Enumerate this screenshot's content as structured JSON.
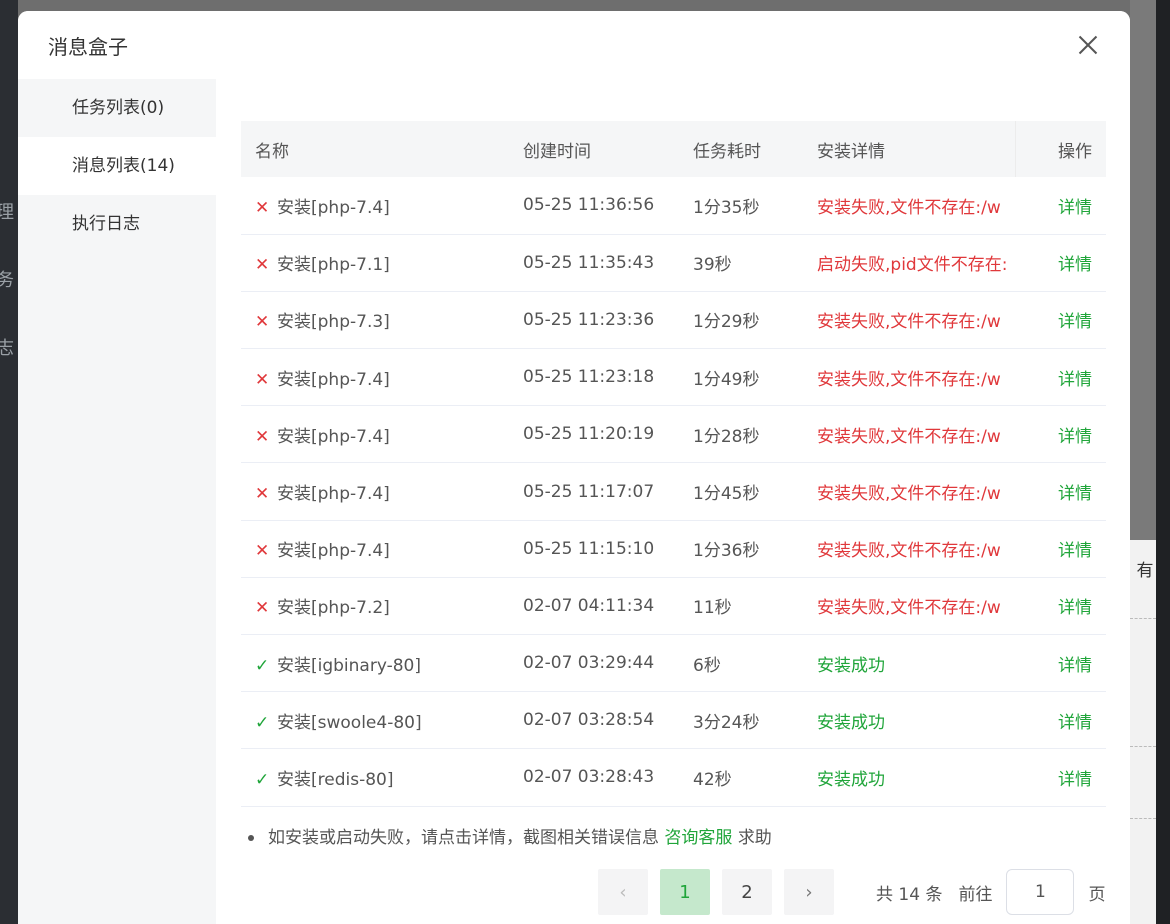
{
  "backdrop": {
    "left_chars": [
      "理",
      "务",
      "志"
    ],
    "right_text": "有"
  },
  "modal": {
    "title": "消息盒子"
  },
  "sidebar": {
    "items": [
      {
        "label": "任务列表(0)"
      },
      {
        "label": "消息列表(14)"
      },
      {
        "label": "执行日志"
      }
    ],
    "active_index": 1
  },
  "table": {
    "columns": [
      "名称",
      "创建时间",
      "任务耗时",
      "安装详情",
      "操作"
    ],
    "rows": [
      {
        "status": "fail",
        "name": "安装[php-7.4]",
        "created": "05-25 11:36:56",
        "duration": "1分35秒",
        "detail": "安装失败,文件不存在:/w",
        "action": "详情"
      },
      {
        "status": "fail",
        "name": "安装[php-7.1]",
        "created": "05-25 11:35:43",
        "duration": "39秒",
        "detail": "启动失败,pid文件不存在:",
        "action": "详情"
      },
      {
        "status": "fail",
        "name": "安装[php-7.3]",
        "created": "05-25 11:23:36",
        "duration": "1分29秒",
        "detail": "安装失败,文件不存在:/w",
        "action": "详情"
      },
      {
        "status": "fail",
        "name": "安装[php-7.4]",
        "created": "05-25 11:23:18",
        "duration": "1分49秒",
        "detail": "安装失败,文件不存在:/w",
        "action": "详情"
      },
      {
        "status": "fail",
        "name": "安装[php-7.4]",
        "created": "05-25 11:20:19",
        "duration": "1分28秒",
        "detail": "安装失败,文件不存在:/w",
        "action": "详情"
      },
      {
        "status": "fail",
        "name": "安装[php-7.4]",
        "created": "05-25 11:17:07",
        "duration": "1分45秒",
        "detail": "安装失败,文件不存在:/w",
        "action": "详情"
      },
      {
        "status": "fail",
        "name": "安装[php-7.4]",
        "created": "05-25 11:15:10",
        "duration": "1分36秒",
        "detail": "安装失败,文件不存在:/w",
        "action": "详情"
      },
      {
        "status": "fail",
        "name": "安装[php-7.2]",
        "created": "02-07 04:11:34",
        "duration": "11秒",
        "detail": "安装失败,文件不存在:/w",
        "action": "详情"
      },
      {
        "status": "ok",
        "name": "安装[igbinary-80]",
        "created": "02-07 03:29:44",
        "duration": "6秒",
        "detail": "安装成功",
        "action": "详情"
      },
      {
        "status": "ok",
        "name": "安装[swoole4-80]",
        "created": "02-07 03:28:54",
        "duration": "3分24秒",
        "detail": "安装成功",
        "action": "详情"
      },
      {
        "status": "ok",
        "name": "安装[redis-80]",
        "created": "02-07 03:28:43",
        "duration": "42秒",
        "detail": "安装成功",
        "action": "详情"
      }
    ]
  },
  "note": {
    "text": "如安装或启动失败，请点击详情，截图相关错误信息",
    "link": "咨询客服",
    "suffix": "求助"
  },
  "pagination": {
    "prev_glyph": "‹",
    "next_glyph": "›",
    "pages": [
      "1",
      "2"
    ],
    "current": "1",
    "total": "共 14 条",
    "goto_label": "前往",
    "goto_value": "1",
    "goto_suffix": "页"
  },
  "colors": {
    "accent_green": "#20a53a",
    "error_red": "#e0383b"
  }
}
